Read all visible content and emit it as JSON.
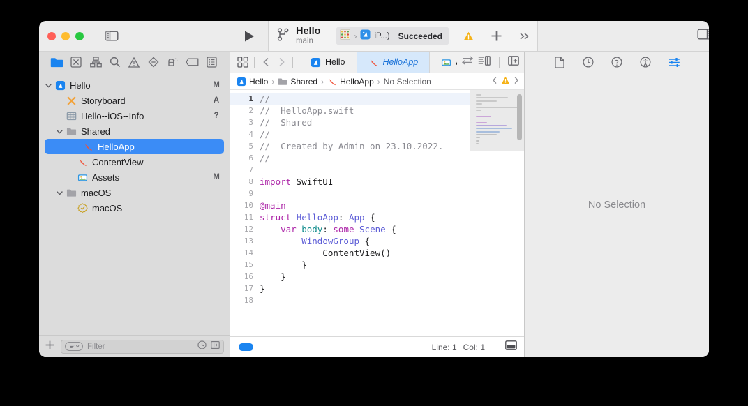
{
  "window": {
    "traffic_lights": [
      "close",
      "minimize",
      "zoom"
    ],
    "colors": {
      "accent": "#3b8cf6",
      "tab_active_bg": "#d6e8fb",
      "tab_active_text": "#1a72d8",
      "swift_orange": "#f05138",
      "warning_yellow": "#f5a623",
      "keyword_magenta": "#ad26a8",
      "type_purple": "#5b5bd6",
      "property_teal": "#138d8d",
      "comment_gray": "#8b8b92"
    }
  },
  "toolbar": {
    "sidebar_toggle": "sidebar-toggle",
    "run_button": "run",
    "project_name": "Hello",
    "branch_name": "main",
    "scheme": {
      "destination": "iP...)",
      "separator": "›",
      "status": "Succeeded"
    },
    "warning_icon": "warning",
    "add_label": "+",
    "more_label": "≫",
    "inspector_toggle": "inspector-toggle"
  },
  "navigator": {
    "tabs": [
      {
        "name": "project-navigator",
        "active": true
      },
      {
        "name": "source-control-navigator",
        "active": false
      },
      {
        "name": "symbol-navigator",
        "active": false
      },
      {
        "name": "find-navigator",
        "active": false
      },
      {
        "name": "issue-navigator",
        "active": false
      },
      {
        "name": "test-navigator",
        "active": false
      },
      {
        "name": "debug-navigator",
        "active": false
      },
      {
        "name": "breakpoint-navigator",
        "active": false
      },
      {
        "name": "report-navigator",
        "active": false
      }
    ],
    "tree": [
      {
        "label": "Hello",
        "icon": "xcode-project",
        "indent": 0,
        "disclosure": "open",
        "badge": "M",
        "selected": false
      },
      {
        "label": "Storyboard",
        "icon": "storyboard",
        "indent": 1,
        "disclosure": "none",
        "badge": "A",
        "selected": false
      },
      {
        "label": "Hello--iOS--Info",
        "icon": "plist",
        "indent": 1,
        "disclosure": "none",
        "badge": "?",
        "selected": false
      },
      {
        "label": "Shared",
        "icon": "folder",
        "indent": 1,
        "disclosure": "open",
        "badge": "",
        "selected": false
      },
      {
        "label": "HelloApp",
        "icon": "swift",
        "indent": 2,
        "disclosure": "none",
        "badge": "",
        "selected": true
      },
      {
        "label": "ContentView",
        "icon": "swift",
        "indent": 2,
        "disclosure": "none",
        "badge": "",
        "selected": false
      },
      {
        "label": "Assets",
        "icon": "assets",
        "indent": 2,
        "disclosure": "none",
        "badge": "M",
        "selected": false
      },
      {
        "label": "macOS",
        "icon": "folder",
        "indent": 1,
        "disclosure": "open",
        "badge": "",
        "selected": false
      },
      {
        "label": "macOS",
        "icon": "entitlements",
        "indent": 2,
        "disclosure": "none",
        "badge": "",
        "selected": false
      }
    ],
    "add_button": "+",
    "filter_placeholder": "Filter",
    "filter_value": "",
    "recent_icon": "clock-icon",
    "sourcecontrol_icon": "source-control-filter-icon"
  },
  "editor": {
    "tabs": [
      {
        "label": "Hello",
        "icon": "xcode-project",
        "active": false
      },
      {
        "label": "HelloApp",
        "icon": "swift",
        "active": true
      },
      {
        "label": "Asse",
        "icon": "assets",
        "active": false
      }
    ],
    "breadcrumb": [
      {
        "label": "Hello",
        "icon": "xcode-project"
      },
      {
        "label": "Shared",
        "icon": "folder"
      },
      {
        "label": "HelloApp",
        "icon": "swift"
      },
      {
        "label": "No Selection",
        "icon": "none"
      }
    ],
    "breadcrumb_separator": "›",
    "code_lines": [
      {
        "n": "1",
        "current": true,
        "tokens": [
          {
            "t": "//",
            "c": "cmt"
          }
        ]
      },
      {
        "n": "2",
        "current": false,
        "tokens": [
          {
            "t": "//  HelloApp.swift",
            "c": "cmt"
          }
        ]
      },
      {
        "n": "3",
        "current": false,
        "tokens": [
          {
            "t": "//  Shared",
            "c": "cmt"
          }
        ]
      },
      {
        "n": "4",
        "current": false,
        "tokens": [
          {
            "t": "//",
            "c": "cmt"
          }
        ]
      },
      {
        "n": "5",
        "current": false,
        "tokens": [
          {
            "t": "//  Created by Admin on 23.10.2022.",
            "c": "cmt"
          }
        ]
      },
      {
        "n": "6",
        "current": false,
        "tokens": [
          {
            "t": "//",
            "c": "cmt"
          }
        ]
      },
      {
        "n": "7",
        "current": false,
        "tokens": []
      },
      {
        "n": "8",
        "current": false,
        "tokens": [
          {
            "t": "import",
            "c": "kw"
          },
          {
            "t": " SwiftUI",
            "c": "fn"
          }
        ]
      },
      {
        "n": "9",
        "current": false,
        "tokens": []
      },
      {
        "n": "10",
        "current": false,
        "tokens": [
          {
            "t": "@main",
            "c": "kw"
          }
        ]
      },
      {
        "n": "11",
        "current": false,
        "tokens": [
          {
            "t": "struct",
            "c": "kw"
          },
          {
            "t": " ",
            "c": "fn"
          },
          {
            "t": "HelloApp",
            "c": "typ"
          },
          {
            "t": ": ",
            "c": "fn"
          },
          {
            "t": "App",
            "c": "typ"
          },
          {
            "t": " {",
            "c": "fn"
          }
        ]
      },
      {
        "n": "12",
        "current": false,
        "tokens": [
          {
            "t": "    ",
            "c": "fn"
          },
          {
            "t": "var",
            "c": "kw"
          },
          {
            "t": " ",
            "c": "fn"
          },
          {
            "t": "body",
            "c": "prp"
          },
          {
            "t": ": ",
            "c": "fn"
          },
          {
            "t": "some",
            "c": "kw"
          },
          {
            "t": " ",
            "c": "fn"
          },
          {
            "t": "Scene",
            "c": "typ"
          },
          {
            "t": " {",
            "c": "fn"
          }
        ]
      },
      {
        "n": "13",
        "current": false,
        "tokens": [
          {
            "t": "        ",
            "c": "fn"
          },
          {
            "t": "WindowGroup",
            "c": "typ"
          },
          {
            "t": " {",
            "c": "fn"
          }
        ]
      },
      {
        "n": "14",
        "current": false,
        "tokens": [
          {
            "t": "            ContentView()",
            "c": "fn"
          }
        ]
      },
      {
        "n": "15",
        "current": false,
        "tokens": [
          {
            "t": "        }",
            "c": "fn"
          }
        ]
      },
      {
        "n": "16",
        "current": false,
        "tokens": [
          {
            "t": "    }",
            "c": "fn"
          }
        ]
      },
      {
        "n": "17",
        "current": false,
        "tokens": [
          {
            "t": "}",
            "c": "fn"
          }
        ]
      },
      {
        "n": "18",
        "current": false,
        "tokens": []
      }
    ],
    "minimap_lines": [
      {
        "w": 8,
        "color": "#c9c9c9"
      },
      {
        "w": 46,
        "color": "#c9c9c9"
      },
      {
        "w": 30,
        "color": "#c9c9c9"
      },
      {
        "w": 9,
        "color": "#c9c9c9"
      },
      {
        "w": 62,
        "color": "#c9c9c9"
      },
      {
        "w": 8,
        "color": "#c9c9c9"
      },
      {
        "w": 0,
        "color": "transparent"
      },
      {
        "w": 22,
        "color": "#cba6d8"
      },
      {
        "w": 0,
        "color": "transparent"
      },
      {
        "w": 16,
        "color": "#cba6d8"
      },
      {
        "w": 44,
        "color": "#b7a8dd"
      },
      {
        "w": 52,
        "color": "#a8bedd"
      },
      {
        "w": 34,
        "color": "#a8bedd"
      },
      {
        "w": 30,
        "color": "#c2c2c2"
      },
      {
        "w": 6,
        "color": "#c2c2c2"
      },
      {
        "w": 5,
        "color": "#c2c2c2"
      },
      {
        "w": 4,
        "color": "#c2c2c2"
      }
    ],
    "status": {
      "line_label": "Line: 1",
      "col_label": "Col: 1",
      "minimap_toggle": "minimap-toggle"
    },
    "right_icons": [
      "adjust-editor-icon",
      "editor-options-icon",
      "add-editor-icon"
    ]
  },
  "inspector": {
    "tabs": [
      {
        "name": "file-inspector",
        "active": false
      },
      {
        "name": "history-inspector",
        "active": false
      },
      {
        "name": "quick-help-inspector",
        "active": false
      },
      {
        "name": "accessibility-inspector",
        "active": false
      },
      {
        "name": "attributes-inspector",
        "active": true
      }
    ],
    "empty_message": "No Selection"
  }
}
